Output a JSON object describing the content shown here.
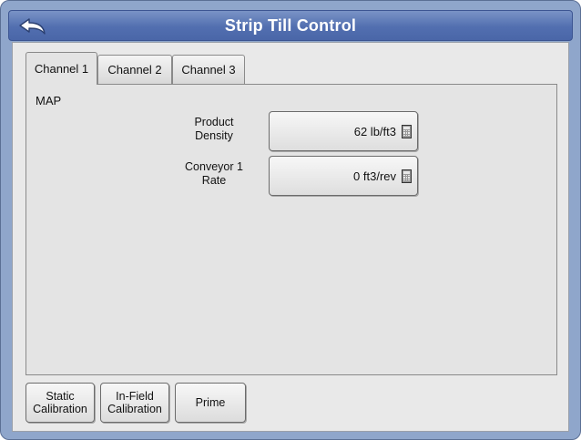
{
  "window": {
    "title": "Strip Till Control",
    "back_icon": "back-arrow-icon"
  },
  "tabs": [
    {
      "label": "Channel 1",
      "active": true
    },
    {
      "label": "Channel 2",
      "active": false
    },
    {
      "label": "Channel 3",
      "active": false
    }
  ],
  "panel": {
    "section_label": "MAP",
    "fields": [
      {
        "label_line1": "Product",
        "label_line2": "Density",
        "value": "62 lb/ft3",
        "icon": "calculator-icon"
      },
      {
        "label_line1": "Conveyor 1",
        "label_line2": "Rate",
        "value": "0 ft3/rev",
        "icon": "calculator-icon"
      }
    ]
  },
  "bottom_buttons": [
    {
      "line1": "Static",
      "line2": "Calibration"
    },
    {
      "line1": "In-Field",
      "line2": "Calibration"
    },
    {
      "line1": "Prime",
      "line2": ""
    }
  ],
  "colors": {
    "title_bar": "#526fb0",
    "frame": "#8fa6cb",
    "content_bg": "#e9e9e9"
  }
}
